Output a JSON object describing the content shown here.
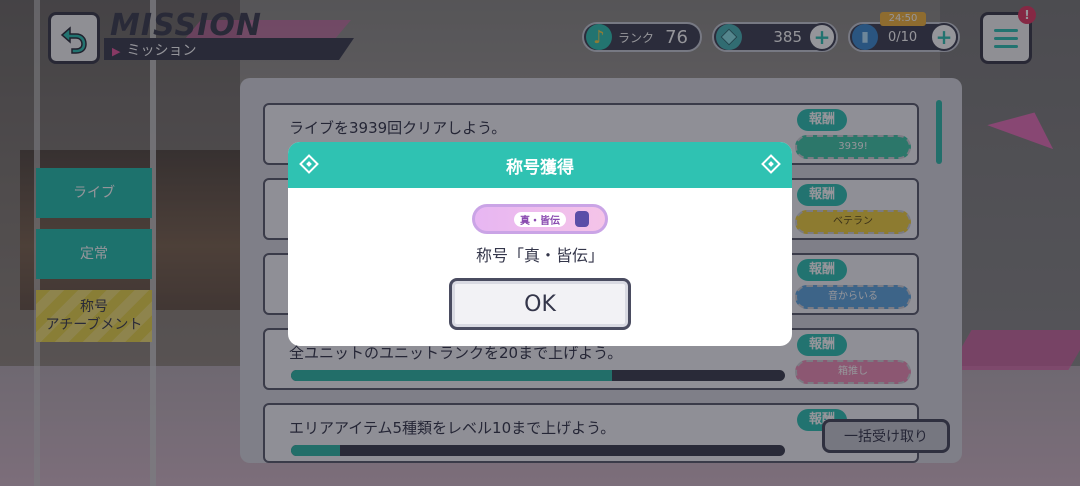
{
  "header": {
    "title_en": "MISSION",
    "title_jp": "ミッション"
  },
  "stats": {
    "rank_label": "ランク",
    "rank_value": "76",
    "gems": "385",
    "stamina": "0/10",
    "stamina_timer": "24:50"
  },
  "tabs": [
    {
      "label": "ライブ"
    },
    {
      "label": "定常"
    },
    {
      "label": "称号\nアチーブメント"
    }
  ],
  "missions": [
    {
      "text": "ライブを3939回クリアしよう。",
      "reward_label": "報酬",
      "reward_item": "3939!",
      "progress": null
    },
    {
      "text": "",
      "reward_label": "報酬",
      "reward_item": "ベテラン",
      "progress": null
    },
    {
      "text": "",
      "reward_label": "報酬",
      "reward_item": "音からいる",
      "progress": null
    },
    {
      "text": "全ユニットのユニットランクを20まで上げよう。",
      "reward_label": "報酬",
      "reward_item": "箱推し",
      "progress": 0.65
    },
    {
      "text": "エリアアイテム5種類をレベル10まで上げよう。",
      "reward_label": "報酬",
      "reward_item": "",
      "progress": 0.1
    }
  ],
  "bulk_button": "一括受け取り",
  "modal": {
    "title": "称号獲得",
    "badge_text": "真・皆伝",
    "message": "称号「真・皆伝」",
    "ok_label": "OK"
  },
  "colors": {
    "accent": "#2fc2b2",
    "dark": "#3b3c4e",
    "pink": "#e465b0"
  }
}
